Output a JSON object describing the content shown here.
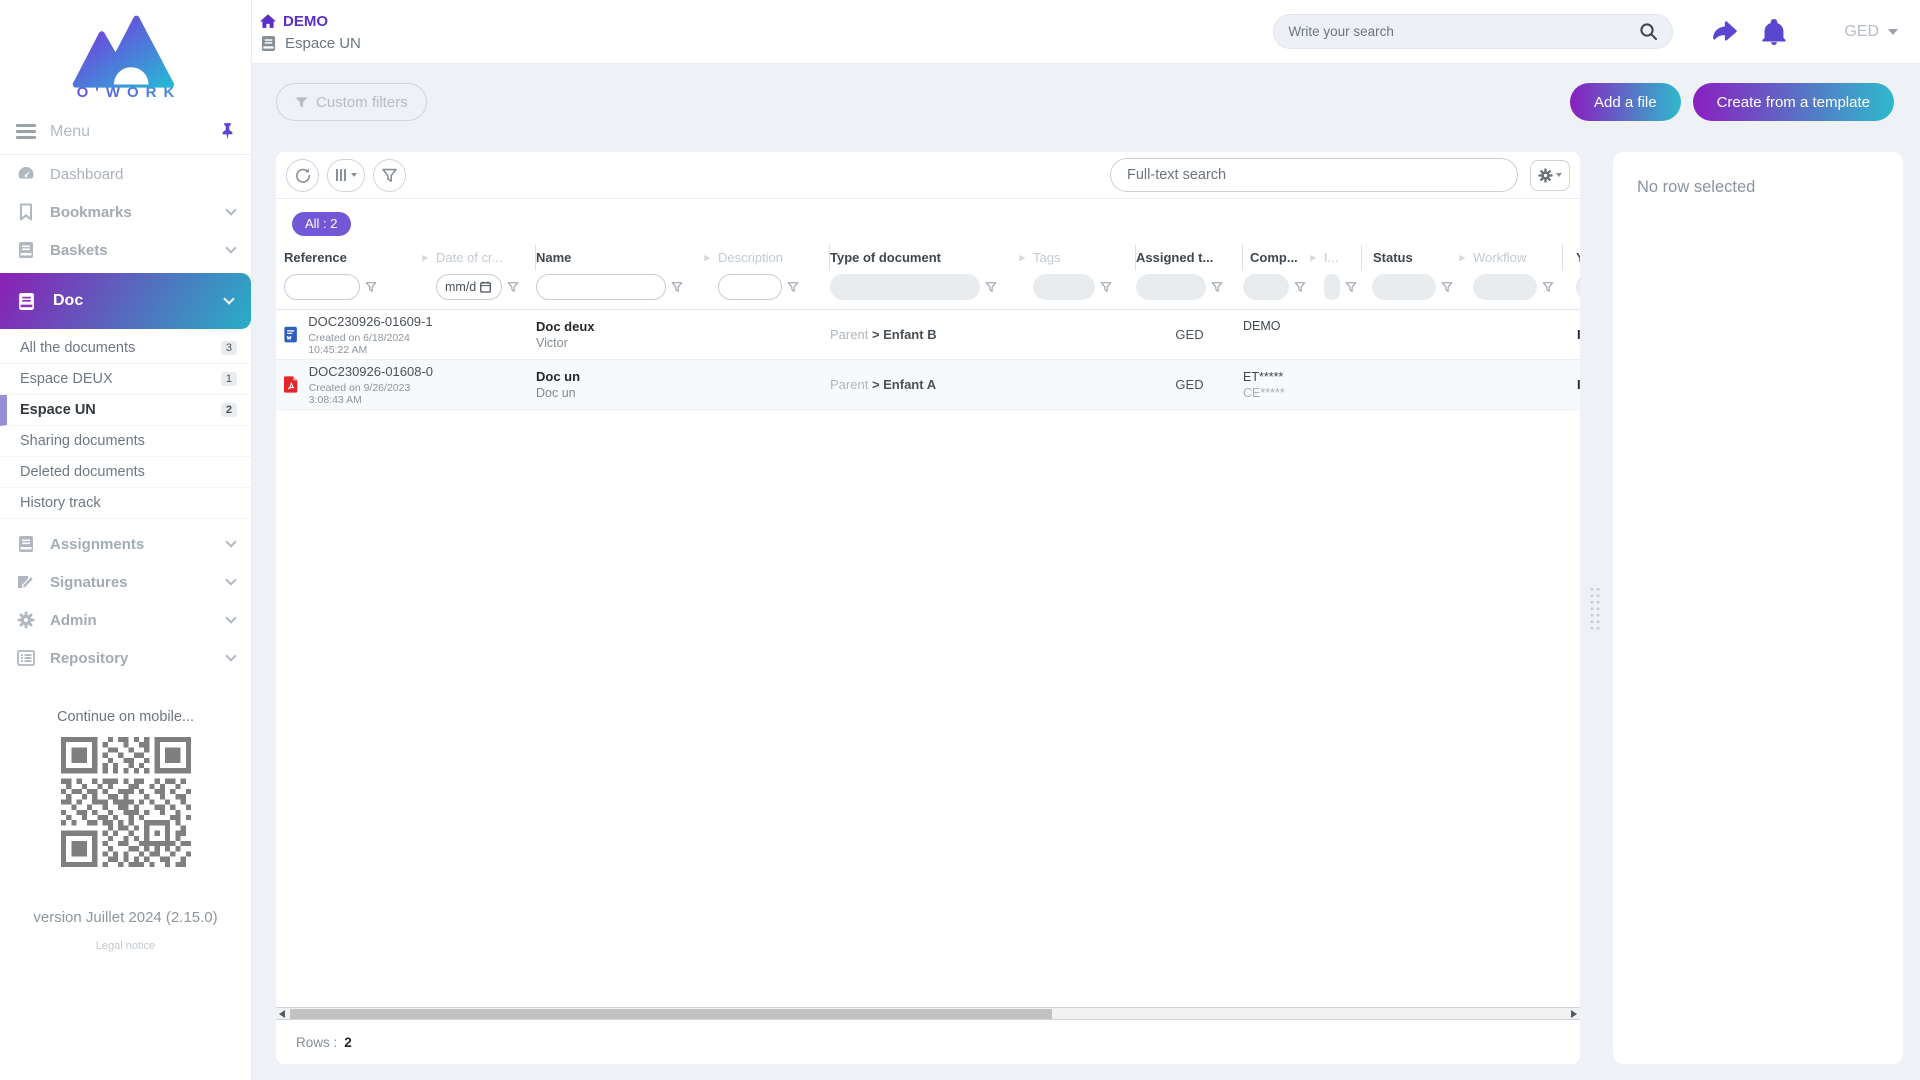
{
  "brand": {
    "logo_text": "O'WORK"
  },
  "header": {
    "breadcrumb_root": "DEMO",
    "breadcrumb_space": "Espace UN",
    "search_placeholder": "Write your search",
    "user_label": "GED"
  },
  "actionbar": {
    "custom_filters_label": "Custom filters",
    "add_file_label": "Add a file",
    "create_template_label": "Create from a template"
  },
  "sidebar": {
    "menu_label": "Menu",
    "dashboard": "Dashboard",
    "bookmarks": "Bookmarks",
    "baskets": "Baskets",
    "doc": "Doc",
    "doc_children": [
      {
        "label": "All the documents",
        "count": "3"
      },
      {
        "label": "Espace DEUX",
        "count": "1"
      },
      {
        "label": "Espace UN",
        "count": "2"
      },
      {
        "label": "Sharing documents"
      },
      {
        "label": "Deleted documents"
      },
      {
        "label": "History track"
      }
    ],
    "assignments": "Assignments",
    "signatures": "Signatures",
    "admin": "Admin",
    "repository": "Repository",
    "mobile_hint": "Continue on mobile...",
    "version": "version Juillet 2024 (2.15.0)",
    "legal": "Legal notice"
  },
  "table": {
    "fulltext_placeholder": "Full-text search",
    "all_badge": "All : 2",
    "columns": [
      "Reference",
      "Date of cr...",
      "Name",
      "Description",
      "Type of document",
      "Tags",
      "Assigned t...",
      "Comp...",
      "I...",
      "Status",
      "Workflow",
      "Y"
    ],
    "date_filter_value": "mm/d",
    "rows": [
      {
        "icon": "word-document-icon",
        "reference": "DOC230926-01609-1",
        "created": "Created on 6/18/2024 10:45:22 AM",
        "name": "Doc deux",
        "subname": "Victor",
        "type_parent": "Parent",
        "type_child": "> Enfant B",
        "assigned": "GED",
        "comp_line1": "DEMO",
        "comp_line2": "",
        "clipped": "I"
      },
      {
        "icon": "pdf-document-icon",
        "reference": "DOC230926-01608-0",
        "created": "Created on 9/26/2023 3:08:43 AM",
        "name": "Doc un",
        "subname": "Doc un",
        "type_parent": "Parent",
        "type_child": "> Enfant A",
        "assigned": "GED",
        "comp_line1": "ET*****",
        "comp_line2": "CE*****",
        "clipped": "I"
      }
    ],
    "footer": {
      "rows_label": "Rows :",
      "rows_value": "2"
    }
  },
  "detail_panel": {
    "empty_text": "No row selected"
  },
  "colors": {
    "accent_purple": "#5a47cf",
    "breadcrumb_purple": "#5b2fc7",
    "badge_purple": "#7258d6",
    "gradient_start": "#8a1fc0",
    "gradient_end": "#2fb9cc",
    "background": "#eef1f6"
  }
}
